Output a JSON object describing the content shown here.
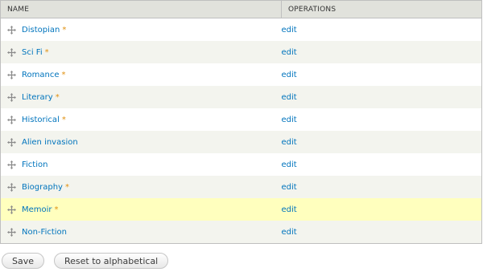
{
  "table": {
    "headers": {
      "name": "NAME",
      "operations": "OPERATIONS"
    },
    "rows": [
      {
        "name": "Distopian",
        "changed_mark": "*",
        "operation": "edit"
      },
      {
        "name": "Sci Fi",
        "changed_mark": "*",
        "operation": "edit"
      },
      {
        "name": "Romance",
        "changed_mark": "*",
        "operation": "edit"
      },
      {
        "name": "Literary",
        "changed_mark": "*",
        "operation": "edit"
      },
      {
        "name": "Historical",
        "changed_mark": "*",
        "operation": "edit"
      },
      {
        "name": "Alien invasion",
        "changed_mark": "",
        "operation": "edit"
      },
      {
        "name": "Fiction",
        "changed_mark": "",
        "operation": "edit"
      },
      {
        "name": "Biography",
        "changed_mark": "*",
        "operation": "edit"
      },
      {
        "name": "Memoir",
        "changed_mark": "*",
        "operation": "edit"
      },
      {
        "name": "Non-Fiction",
        "changed_mark": "",
        "operation": "edit"
      }
    ],
    "highlighted_row_index": 8
  },
  "actions": {
    "save_label": "Save",
    "reset_label": "Reset to alphabetical"
  },
  "icons": {
    "row_handle": "drag-handle-icon"
  },
  "colors": {
    "link": "#0074bd",
    "changed_mark": "#e09010",
    "header_bg": "#e1e2dc",
    "even_row_bg": "#f3f4ee",
    "highlight_bg": "#ffffbe"
  }
}
